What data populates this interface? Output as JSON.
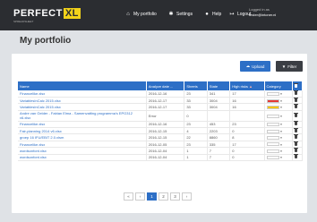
{
  "app": {
    "logo_text": "PERFECT",
    "logo_xl": "XL",
    "logo_sub": "SPREADSHEET"
  },
  "nav": {
    "items": [
      {
        "label": "My portfolio",
        "icon": "home-icon"
      },
      {
        "label": "Settings",
        "icon": "gear-icon"
      },
      {
        "label": "Help",
        "icon": "help-icon"
      },
      {
        "label": "Logout",
        "icon": "logout-icon"
      }
    ],
    "user_line1": "Logged in as",
    "user_line2": "tester@intoner.nl"
  },
  "page": {
    "title": "My portfolio"
  },
  "toolbar": {
    "upload_label": "Upload",
    "filter_label": "Filter"
  },
  "table": {
    "columns": [
      "Name",
      "Analyze date ...",
      "Sheets",
      "State",
      "High risks",
      "Category",
      ""
    ],
    "rows": [
      {
        "name": "Financelike.xlsx",
        "date": "2016-12-16",
        "sheets": "23",
        "state": "341",
        "risks": "17",
        "color": "#ffffff"
      },
      {
        "name": "VariablesInCalc 2015.xlsx",
        "date": "2016-12-17",
        "sheets": "33",
        "state": "3004",
        "risks": "16",
        "color": "#e53935"
      },
      {
        "name": "VariablesInCalc 2015.xlsx",
        "date": "2016-12-17",
        "sheets": "33",
        "state": "3004",
        "risks": "16",
        "color": "#f5c400"
      },
      {
        "name": "Andre van Gelder - Fabian Elma - Samenvatting programma's EPO312 v6.xlsx",
        "date": "Error",
        "sheets": "0",
        "state": "",
        "risks": "",
        "color": "#ffffff",
        "tall": true
      },
      {
        "name": "Financelike.xlsx",
        "date": "2016-12-16",
        "sheets": "23",
        "state": "453",
        "risks": "23",
        "color": "#ffffff"
      },
      {
        "name": "Fair-planning 2014 v6.xlsx",
        "date": "2016-12-15",
        "sheets": "4",
        "state": "2203",
        "risks": "0",
        "color": "#ffffff"
      },
      {
        "name": "groep 16 IFU/EBIT 2.0.xlsm",
        "date": "2016-12-15",
        "sheets": "22",
        "state": "8860",
        "risks": "8",
        "color": "#ffffff"
      },
      {
        "name": "Financelike.xlsx",
        "date": "2016-12-05",
        "sheets": "23",
        "state": "335",
        "risks": "17",
        "color": "#ffffff"
      },
      {
        "name": "wordsonfont.xlsx",
        "date": "2016-12-04",
        "sheets": "1",
        "state": "7",
        "risks": "0",
        "color": "#ffffff"
      },
      {
        "name": "wordsonfont.xlsx",
        "date": "2016-12-04",
        "sheets": "1",
        "state": "7",
        "risks": "0",
        "color": "#ffffff"
      }
    ]
  },
  "pager": {
    "prev2": "«",
    "prev": "‹",
    "pages": [
      "1",
      "2",
      "3"
    ],
    "next": "›"
  }
}
